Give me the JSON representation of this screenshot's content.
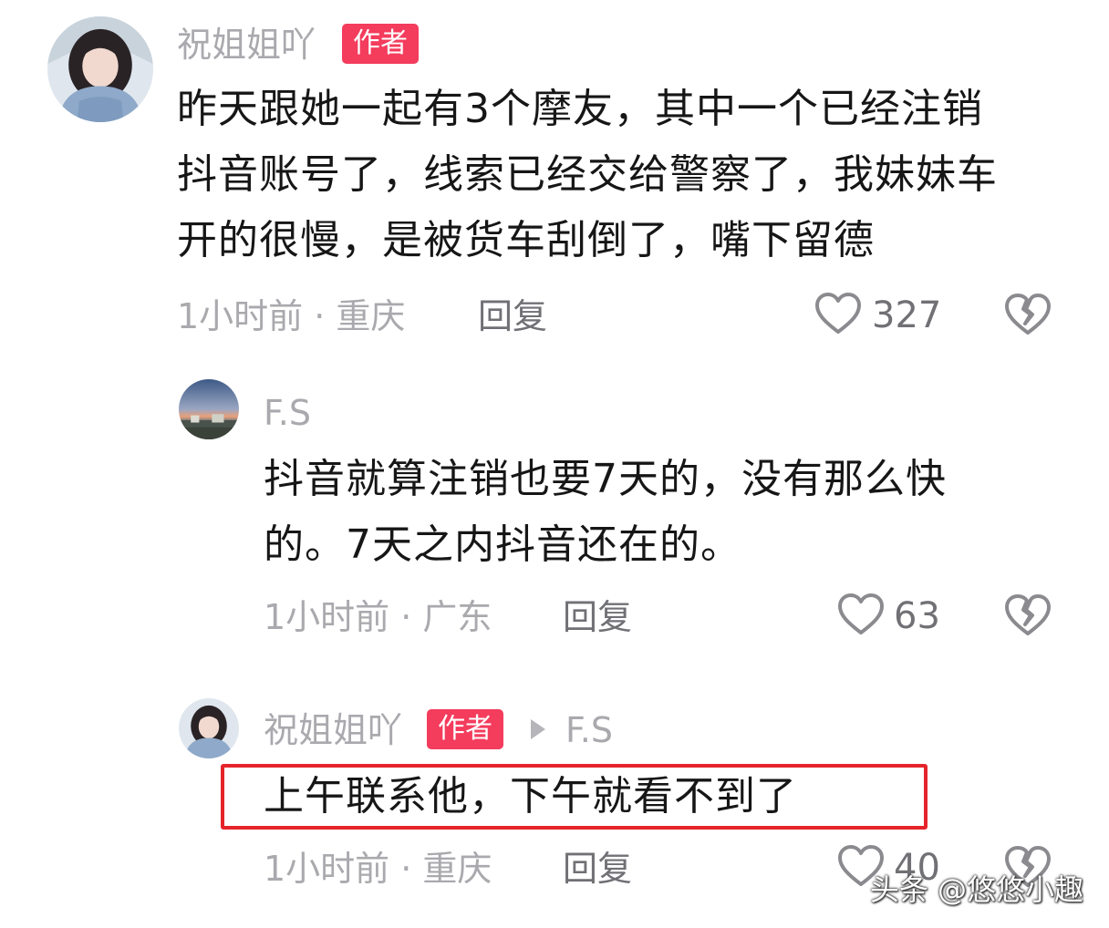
{
  "comments": [
    {
      "nickname": "祝姐姐吖",
      "badge": "作者",
      "lines": [
        "昨天跟她一起有3个摩友，其中一个已经注销",
        "抖音账号了，线索已经交给警察了，我妹妹车",
        "开的很慢，是被货车刮倒了，嘴下留德"
      ],
      "meta": "1小时前 · 重庆",
      "reply": "回复",
      "likes": "327"
    },
    {
      "nickname": "F.S",
      "lines": [
        "抖音就算注销也要7天的，没有那么快",
        "的。7天之内抖音还在的。"
      ],
      "meta": "1小时前 · 广东",
      "reply": "回复",
      "likes": "63"
    },
    {
      "nickname": "祝姐姐吖",
      "badge": "作者",
      "reply_to": "F.S",
      "lines": [
        "上午联系他，下午就看不到了"
      ],
      "meta": "1小时前 · 重庆",
      "reply": "回复",
      "likes": "40"
    }
  ],
  "watermark": "头条 @悠悠小趣",
  "colors": {
    "badge": "#f43c5d",
    "highlight": "#e5242a",
    "muted": "#a9a9ae"
  },
  "icons": [
    "heart-outline-icon",
    "broken-heart-icon",
    "play-arrow-icon"
  ]
}
